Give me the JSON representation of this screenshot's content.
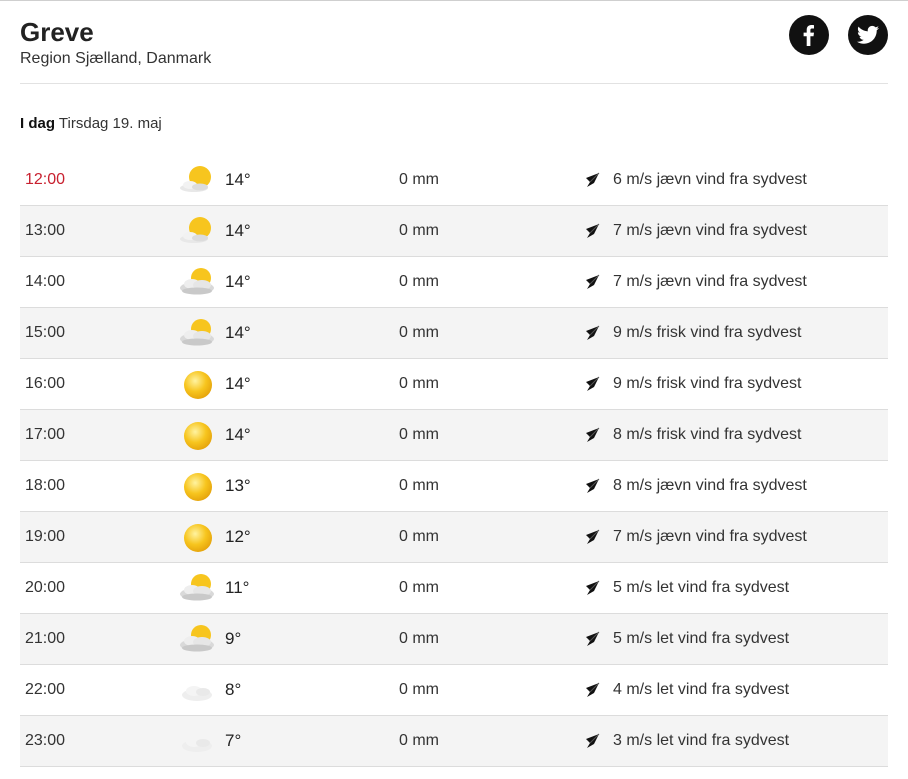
{
  "location": {
    "city": "Greve",
    "region": "Region Sjælland, Danmark"
  },
  "social": [
    {
      "name": "facebook-button",
      "icon": "facebook-icon"
    },
    {
      "name": "twitter-button",
      "icon": "twitter-icon"
    }
  ],
  "day": {
    "label": "I dag",
    "date": "Tirsdag 19. maj"
  },
  "colors": {
    "current_time": "#c8202f",
    "alt_row": "#f4f4f4",
    "sun": "#f7c51e"
  },
  "hours": [
    {
      "time": "12:00",
      "icon": "partly-sunny",
      "temp": "14°",
      "precip": "0 mm",
      "wind": "6 m/s jævn vind fra sydvest",
      "current": true
    },
    {
      "time": "13:00",
      "icon": "partly-sunny",
      "temp": "14°",
      "precip": "0 mm",
      "wind": "7 m/s jævn vind fra sydvest"
    },
    {
      "time": "14:00",
      "icon": "sun-cloud",
      "temp": "14°",
      "precip": "0 mm",
      "wind": "7 m/s jævn vind fra sydvest"
    },
    {
      "time": "15:00",
      "icon": "sun-cloud",
      "temp": "14°",
      "precip": "0 mm",
      "wind": "9 m/s frisk vind fra sydvest"
    },
    {
      "time": "16:00",
      "icon": "sun",
      "temp": "14°",
      "precip": "0 mm",
      "wind": "9 m/s frisk vind fra sydvest"
    },
    {
      "time": "17:00",
      "icon": "sun",
      "temp": "14°",
      "precip": "0 mm",
      "wind": "8 m/s frisk vind fra sydvest"
    },
    {
      "time": "18:00",
      "icon": "sun",
      "temp": "13°",
      "precip": "0 mm",
      "wind": "8 m/s jævn vind fra sydvest"
    },
    {
      "time": "19:00",
      "icon": "sun",
      "temp": "12°",
      "precip": "0 mm",
      "wind": "7 m/s jævn vind fra sydvest"
    },
    {
      "time": "20:00",
      "icon": "sun-cloud",
      "temp": "11°",
      "precip": "0 mm",
      "wind": "5 m/s let vind fra sydvest"
    },
    {
      "time": "21:00",
      "icon": "sun-cloud",
      "temp": "9°",
      "precip": "0 mm",
      "wind": "5 m/s let vind fra sydvest"
    },
    {
      "time": "22:00",
      "icon": "light-cloud",
      "temp": "8°",
      "precip": "0 mm",
      "wind": "4 m/s let vind fra sydvest"
    },
    {
      "time": "23:00",
      "icon": "light-cloud",
      "temp": "7°",
      "precip": "0 mm",
      "wind": "3 m/s let vind fra sydvest"
    }
  ]
}
